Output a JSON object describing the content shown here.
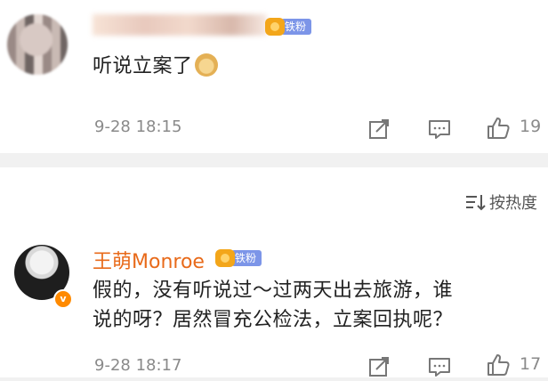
{
  "comments": [
    {
      "fan_badge": "铁粉",
      "text": "听说立案了",
      "emoji": "doge-emoji",
      "time": "9-28 18:15",
      "likes": "19"
    },
    {
      "username": "王萌Monroe",
      "fan_badge": "铁粉",
      "text_line1": "假的，没有听说过～过两天出去旅游，谁",
      "text_line2": "说的呀？居然冒充公检法，立案回执呢？",
      "time": "9-28 18:17",
      "likes": "17",
      "vip_mark": "v"
    }
  ],
  "sort": {
    "label": "按热度"
  },
  "icons": {
    "share": "share-icon",
    "comment": "comment-icon",
    "like": "thumbs-up-icon",
    "sort": "sort-icon"
  },
  "colors": {
    "username": "#e86a1a",
    "fan_badge": "#7c95e8",
    "meta_text": "#8a8a8a",
    "divider": "#f1f1f1",
    "vip": "#ff8a00"
  }
}
